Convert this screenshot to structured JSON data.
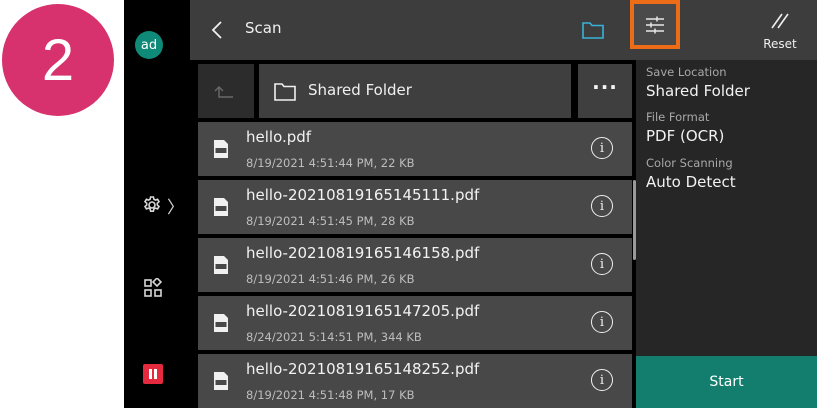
{
  "step": {
    "number": "2"
  },
  "user": {
    "initials": "ad"
  },
  "header": {
    "title": "Scan",
    "reset_label": "Reset"
  },
  "location": {
    "folder_name": "Shared Folder",
    "more_label": "···"
  },
  "files": [
    {
      "name": "hello.pdf",
      "meta": "8/19/2021 4:51:44 PM, 22 KB"
    },
    {
      "name": "hello-20210819165145111.pdf",
      "meta": "8/19/2021 4:51:45 PM, 28 KB"
    },
    {
      "name": "hello-20210819165146158.pdf",
      "meta": "8/19/2021 4:51:46 PM, 26 KB"
    },
    {
      "name": "hello-20210819165147205.pdf",
      "meta": "8/24/2021 5:14:51 PM, 344 KB"
    },
    {
      "name": "hello-20210819165148252.pdf",
      "meta": "8/19/2021 4:51:48 PM, 17 KB"
    }
  ],
  "info_glyph": "i",
  "settings": {
    "save_location_label": "Save Location",
    "save_location_value": "Shared Folder",
    "file_format_label": "File Format",
    "file_format_value": "PDF (OCR)",
    "color_scanning_label": "Color Scanning",
    "color_scanning_value": "Auto Detect"
  },
  "start_label": "Start",
  "colors": {
    "accent": "#147e6e",
    "highlight": "#ed6c18",
    "badge": "#d7326e",
    "stop": "#e5293f",
    "avatar": "#0f8a78"
  },
  "icons": [
    "back-arrow-icon",
    "folder-icon",
    "sliders-icon",
    "reset-icon",
    "up-arrow-icon",
    "pdf-file-icon",
    "info-icon",
    "gear-icon",
    "apps-icon",
    "pause-icon"
  ]
}
